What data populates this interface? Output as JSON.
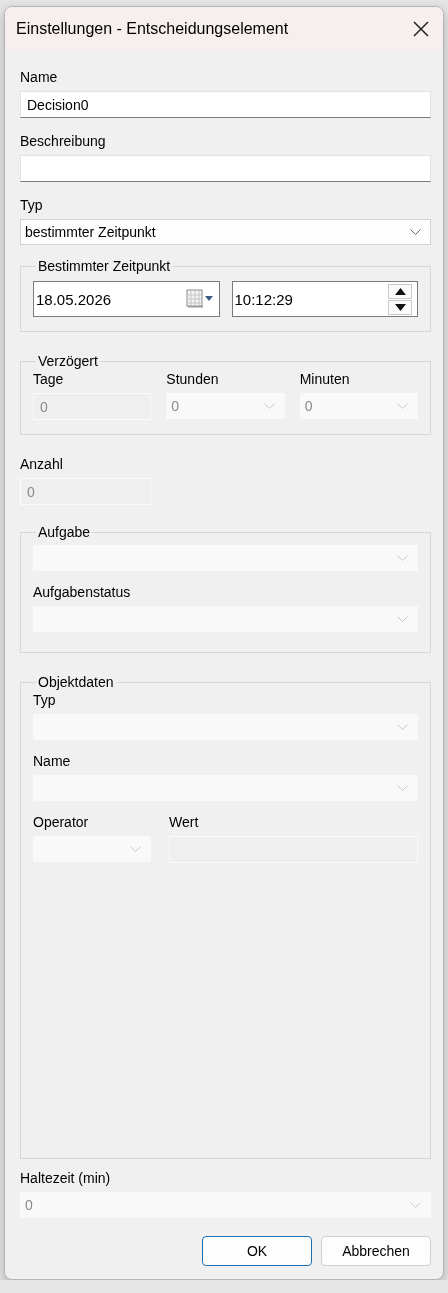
{
  "window": {
    "title": "Einstellungen - Entscheidungselement"
  },
  "name": {
    "kind": "text",
    "label": "Name",
    "value": "Decision0",
    "disabled": false
  },
  "beschreibung": {
    "kind": "text",
    "label": "Beschreibung",
    "disabled": false
  },
  "typ": {
    "kind": "dropdown",
    "label": "Typ",
    "value": "bestimmter Zeitpunkt",
    "disabled": false
  },
  "bestimmter_zeitpunkt": {
    "legend": "Bestimmter Zeitpunkt",
    "rows": [
      [
        {
          "kind": "date",
          "value": "18.05.2026",
          "disabled": false
        },
        {
          "kind": "time",
          "value": "10:12:29",
          "disabled": false
        }
      ]
    ]
  },
  "verzoegert": {
    "legend": "Verzögert",
    "rows": [
      [
        {
          "kind": "text",
          "label": "Tage",
          "value": "0",
          "disabled": true
        },
        {
          "kind": "dropdown",
          "label": "Stunden",
          "value": "0",
          "disabled": true
        },
        {
          "kind": "dropdown",
          "label": "Minuten",
          "value": "0",
          "disabled": true
        }
      ]
    ]
  },
  "anzahl": {
    "kind": "text",
    "label": "Anzahl",
    "value": "0",
    "disabled": true
  },
  "aufgabe": {
    "legend": "Aufgabe",
    "rows": [
      [
        {
          "kind": "dropdown",
          "disabled": true
        }
      ],
      [
        {
          "kind": "dropdown",
          "label": "Aufgabenstatus",
          "disabled": true
        }
      ]
    ]
  },
  "objektdaten": {
    "legend": "Objektdaten",
    "rows": [
      [
        {
          "kind": "dropdown",
          "label": "Typ",
          "disabled": true
        }
      ],
      [
        {
          "kind": "dropdown",
          "label": "Name",
          "disabled": true
        }
      ],
      [
        {
          "kind": "dropdown",
          "label": "Operator",
          "disabled": true
        },
        {
          "kind": "text",
          "label": "Wert",
          "disabled": true
        }
      ]
    ]
  },
  "haltezeit": {
    "kind": "dropdown",
    "label": "Haltezeit (min)",
    "value": "0",
    "disabled": true
  },
  "buttons": [
    {
      "label": "OK",
      "default": true
    },
    {
      "label": "Abbrechen",
      "default": false
    }
  ]
}
